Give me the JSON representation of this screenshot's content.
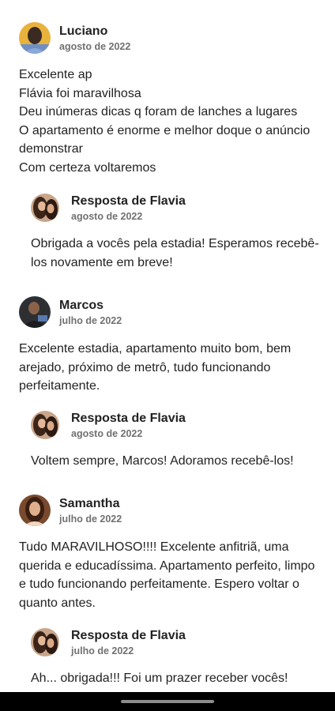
{
  "reviews": [
    {
      "name": "Luciano",
      "date": "agosto de 2022",
      "text": "Excelente ap\nFlávia foi maravilhosa\nDeu inúmeras dicas q foram de lanches a lugares\nO apartamento é enorme e melhor doque o anúncio demonstrar\nCom certeza voltaremos",
      "reply": {
        "title": "Resposta de Flavia",
        "date": "agosto de 2022",
        "text": "Obrigada a vocês pela estadia! Esperamos recebê-los novamente em breve!"
      }
    },
    {
      "name": "Marcos",
      "date": "julho de 2022",
      "text": "Excelente estadia, apartamento muito bom, bem arejado, próximo de metrô, tudo funcionando perfeitamente.",
      "reply": {
        "title": "Resposta de Flavia",
        "date": "agosto de 2022",
        "text": "Voltem sempre, Marcos! Adoramos recebê-los!"
      }
    },
    {
      "name": "Samantha",
      "date": "julho de 2022",
      "text": "Tudo MARAVILHOSO!!!! Excelente anfitriã, uma querida e educadíssima. Apartamento perfeito, limpo e tudo funcionando perfeitamente. Espero voltar o quanto antes.",
      "reply": {
        "title": "Resposta de Flavia",
        "date": "julho de 2022",
        "text": "Ah... obrigada!!! Foi um prazer receber vocês!"
      }
    }
  ]
}
